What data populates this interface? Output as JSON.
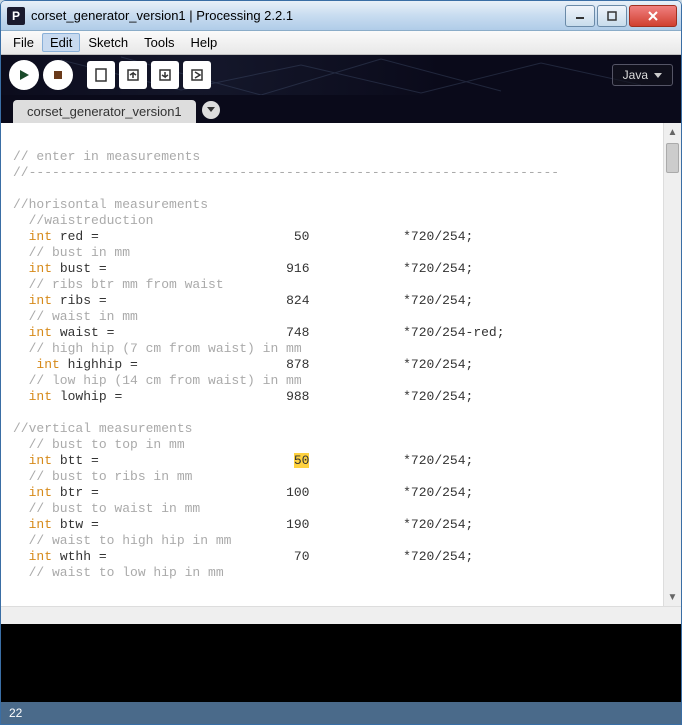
{
  "window": {
    "title": "corset_generator_version1 | Processing 2.2.1",
    "app_icon_letter": "P"
  },
  "menu": [
    "File",
    "Edit",
    "Sketch",
    "Tools",
    "Help"
  ],
  "menu_selected_index": 1,
  "mode": {
    "label": "Java"
  },
  "tabs": [
    {
      "label": "corset_generator_version1"
    }
  ],
  "status": {
    "line": "22"
  },
  "code": {
    "lines": [
      {
        "type": "blank"
      },
      {
        "type": "cmt",
        "text": "// enter in measurements"
      },
      {
        "type": "cmt",
        "text": "//--------------------------------------------------------------------"
      },
      {
        "type": "blank"
      },
      {
        "type": "cmt",
        "text": "//horisontal measurements"
      },
      {
        "type": "cmt",
        "text": "  //waistreduction"
      },
      {
        "type": "decl",
        "indent": "  ",
        "kw": "int",
        "name": "red",
        "value": "50",
        "tail": "*720/254;"
      },
      {
        "type": "cmt",
        "text": "  // bust in mm"
      },
      {
        "type": "decl",
        "indent": "  ",
        "kw": "int",
        "name": "bust",
        "value": "916",
        "tail": "*720/254;"
      },
      {
        "type": "cmt",
        "text": "  // ribs btr mm from waist"
      },
      {
        "type": "decl",
        "indent": "  ",
        "kw": "int",
        "name": "ribs",
        "value": "824",
        "tail": "*720/254;"
      },
      {
        "type": "cmt",
        "text": "  // waist in mm"
      },
      {
        "type": "decl",
        "indent": "  ",
        "kw": "int",
        "name": "waist",
        "value": "748",
        "tail": "*720/254-red;"
      },
      {
        "type": "cmt",
        "text": "  // high hip (7 cm from waist) in mm"
      },
      {
        "type": "decl",
        "indent": "   ",
        "kw": "int",
        "name": "highhip",
        "value": "878",
        "tail": "*720/254;"
      },
      {
        "type": "cmt",
        "text": "  // low hip (14 cm from waist) in mm"
      },
      {
        "type": "decl",
        "indent": "  ",
        "kw": "int",
        "name": "lowhip",
        "value": "988",
        "tail": "*720/254;"
      },
      {
        "type": "blank"
      },
      {
        "type": "cmt",
        "text": "//vertical measurements"
      },
      {
        "type": "cmt",
        "text": "  // bust to top in mm"
      },
      {
        "type": "decl",
        "indent": "  ",
        "kw": "int",
        "name": "btt",
        "value": "50",
        "tail": "*720/254;",
        "highlight_value": true
      },
      {
        "type": "cmt",
        "text": "  // bust to ribs in mm"
      },
      {
        "type": "decl",
        "indent": "  ",
        "kw": "int",
        "name": "btr",
        "value": "100",
        "tail": "*720/254;"
      },
      {
        "type": "cmt",
        "text": "  // bust to waist in mm"
      },
      {
        "type": "decl",
        "indent": "  ",
        "kw": "int",
        "name": "btw",
        "value": "190",
        "tail": "*720/254;"
      },
      {
        "type": "cmt",
        "text": "  // waist to high hip in mm"
      },
      {
        "type": "decl",
        "indent": "  ",
        "kw": "int",
        "name": "wthh",
        "value": "70",
        "tail": "*720/254;"
      },
      {
        "type": "cmt",
        "text": "  // waist to low hip in mm"
      }
    ]
  }
}
